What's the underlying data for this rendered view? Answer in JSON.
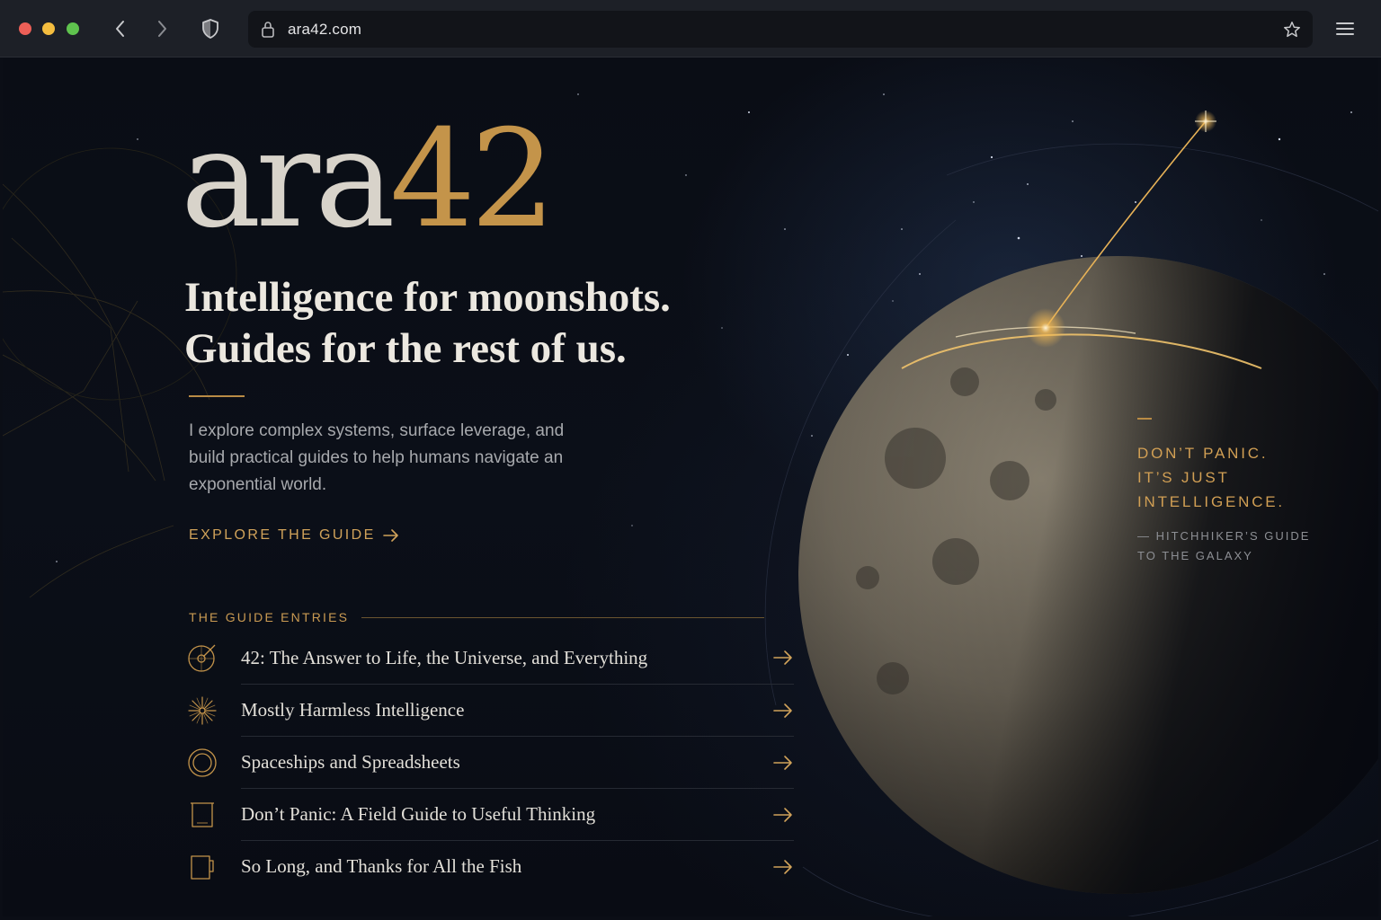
{
  "browser": {
    "url": "ara42.com",
    "icons": {
      "back": "chevron-left-icon",
      "forward": "chevron-right-icon",
      "shield": "shield-icon",
      "lock": "lock-icon",
      "bookmark": "star-icon",
      "menu": "hamburger-menu-icon"
    }
  },
  "hero": {
    "logo_primary": "ara",
    "logo_accent": "42",
    "headline_line1": "Intelligence for moonshots.",
    "headline_line2": "Guides for the rest of us.",
    "intro": "I explore complex systems, surface leverage, and build practical guides to help humans navigate an exponential world.",
    "cta_label": "EXPLORE THE GUIDE",
    "cta_arrow": "→"
  },
  "entries": {
    "title": "THE GUIDE ENTRIES",
    "items": [
      {
        "label": "42: The Answer to Life, the Universe, and Everything",
        "icon": "compass-target-icon"
      },
      {
        "label": "Mostly Harmless Intelligence",
        "icon": "starburst-icon"
      },
      {
        "label": "Spaceships and Spreadsheets",
        "icon": "ring-icon"
      },
      {
        "label": "Don’t Panic: A Field Guide to Useful Thinking",
        "icon": "device-icon"
      },
      {
        "label": "So Long, and Thanks for All the Fish",
        "icon": "mug-icon"
      }
    ]
  },
  "quote": {
    "line1": "DON’T PANIC.",
    "line2": "IT’S JUST",
    "line3": "INTELLIGENCE.",
    "source_line1": "— HITCHHIKER’S GUIDE",
    "source_line2": "TO THE GALAXY"
  },
  "colors": {
    "accent_gold": "#c4944a",
    "background": "#0b0e16",
    "text_light": "#ece8e0",
    "text_muted": "#a7a9ad"
  }
}
